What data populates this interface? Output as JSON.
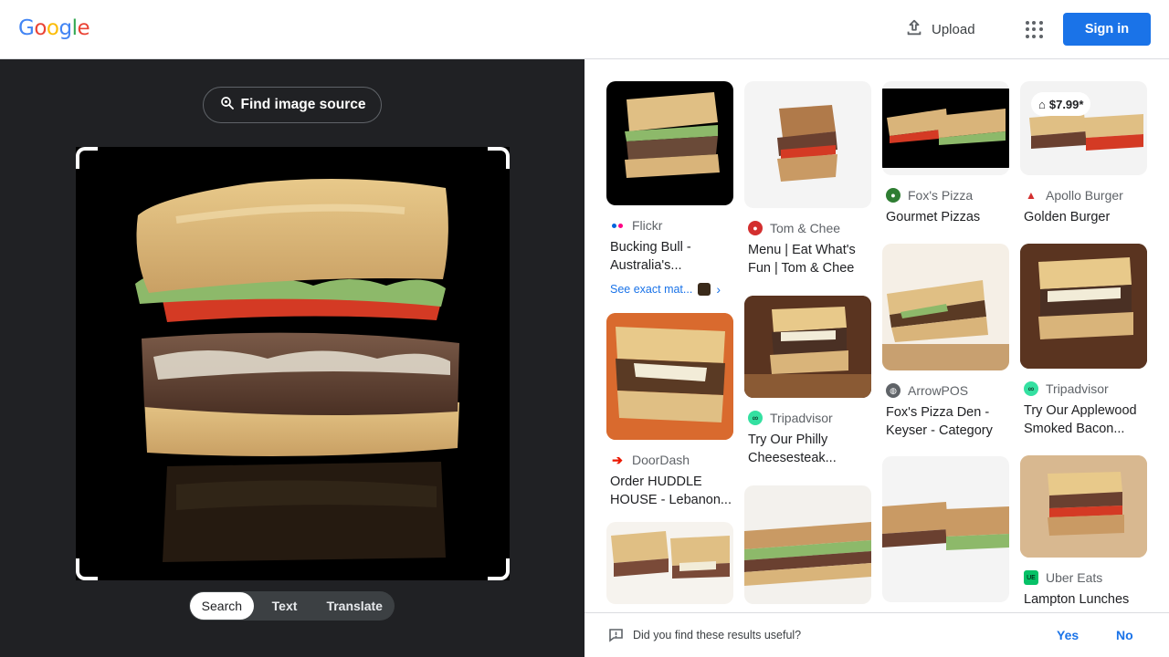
{
  "header": {
    "logo": [
      "G",
      "o",
      "o",
      "g",
      "l",
      "e"
    ],
    "logo_colors": [
      "#4285f4",
      "#ea4335",
      "#fbbc05",
      "#4285f4",
      "#34a853",
      "#ea4335"
    ],
    "upload_label": "Upload",
    "signin_label": "Sign in"
  },
  "left": {
    "find_source_label": "Find image source",
    "modes": [
      {
        "label": "Search",
        "active": true
      },
      {
        "label": "Text",
        "active": false
      },
      {
        "label": "Translate",
        "active": false
      }
    ]
  },
  "results": {
    "col1": [
      {
        "source": "Flickr",
        "title": "Bucking Bull - Australia's...",
        "exact": "See exact mat..."
      },
      {
        "source": "DoorDash",
        "title": "Order HUDDLE HOUSE - Lebanon..."
      }
    ],
    "col2": [
      {
        "source": "Tom & Chee",
        "title": "Menu | Eat What's Fun | Tom & Chee"
      },
      {
        "source": "Tripadvisor",
        "title": "Try Our Philly Cheesesteak..."
      }
    ],
    "col3": [
      {
        "source": "Fox's Pizza",
        "title": "Gourmet Pizzas"
      },
      {
        "source": "ArrowPOS",
        "title": "Fox's Pizza Den - Keyser - Category"
      }
    ],
    "col4": [
      {
        "source": "Apollo Burger",
        "title": "Golden Burger",
        "price": "$7.99*"
      },
      {
        "source": "Tripadvisor",
        "title": "Try Our Applewood Smoked Bacon..."
      },
      {
        "source": "Uber Eats",
        "title": "Lampton Lunches"
      }
    ]
  },
  "feedback": {
    "question": "Did you find these results useful?",
    "yes": "Yes",
    "no": "No"
  },
  "colors": {
    "accent": "#1a73e8",
    "dark_panel": "#202124"
  }
}
